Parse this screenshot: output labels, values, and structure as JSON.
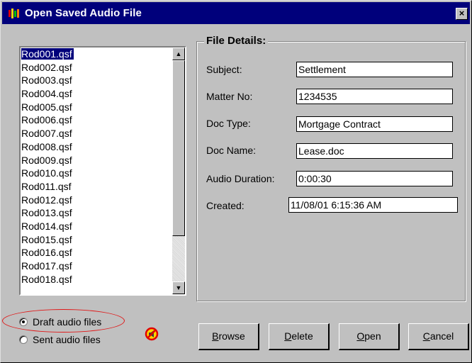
{
  "window": {
    "title": "Open Saved Audio File",
    "close_label": "×"
  },
  "file_list": {
    "items": [
      "Rod001.qsf",
      "Rod002.qsf",
      "Rod003.qsf",
      "Rod004.qsf",
      "Rod005.qsf",
      "Rod006.qsf",
      "Rod007.qsf",
      "Rod008.qsf",
      "Rod009.qsf",
      "Rod010.qsf",
      "Rod011.qsf",
      "Rod012.qsf",
      "Rod013.qsf",
      "Rod014.qsf",
      "Rod015.qsf",
      "Rod016.qsf",
      "Rod017.qsf",
      "Rod018.qsf"
    ],
    "selected_index": 0
  },
  "details": {
    "group_title": "File Details:",
    "fields": [
      {
        "label": "Subject:",
        "value": "Settlement"
      },
      {
        "label": "Matter No:",
        "value": "1234535"
      },
      {
        "label": "Doc Type:",
        "value": "Mortgage Contract"
      },
      {
        "label": "Doc Name:",
        "value": "Lease.doc"
      },
      {
        "label": "Audio Duration:",
        "value": "0:00:30"
      },
      {
        "label": "Created:",
        "value": "11/08/01 6:15:36 AM"
      }
    ]
  },
  "filter": {
    "draft_label": "Draft audio files",
    "sent_label": "Sent audio files",
    "selected": "draft"
  },
  "buttons": {
    "browse": {
      "first": "B",
      "rest": "rowse"
    },
    "delete": {
      "first": "D",
      "rest": "elete"
    },
    "open": {
      "first": "O",
      "rest": "pen"
    },
    "cancel": {
      "first": "C",
      "rest": "ancel"
    }
  },
  "colors": {
    "titlebar": "#00007b",
    "highlight_oval": "#e01818"
  }
}
